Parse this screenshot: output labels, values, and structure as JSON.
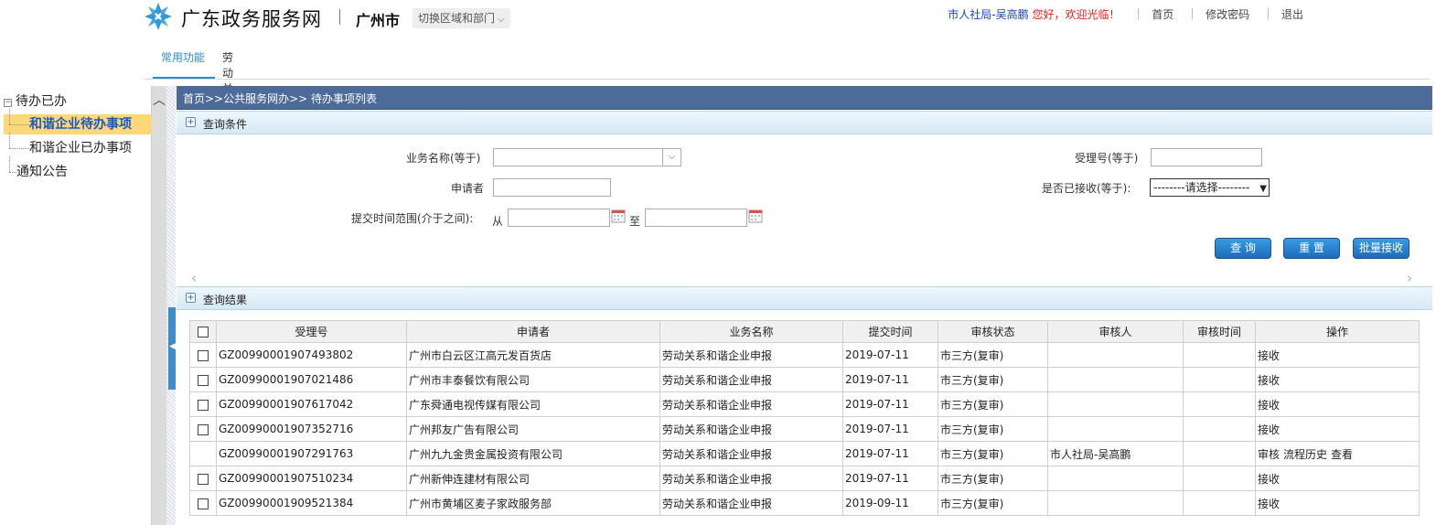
{
  "header": {
    "site_title": "广东政务服务网",
    "city": "广州市",
    "switch_label": "切换区域和部门",
    "user_name": "市人社局-吴高鹏",
    "welcome": " 您好，欢迎光临！",
    "nav": [
      "首页",
      "修改密码",
      "退出"
    ]
  },
  "tabs": [
    "常用功能",
    "劳动关系"
  ],
  "sidebar": {
    "root": "待办已办",
    "items": [
      "和谐企业待办事项",
      "和谐企业已办事项"
    ],
    "notice": "通知公告"
  },
  "breadcrumb": "首页>>公共服务网办>> 待办事项列表",
  "query": {
    "section_title": "查询条件",
    "biz_name_label": "业务名称(等于)",
    "biz_name_value": "",
    "applicant_label": "申请者",
    "applicant_value": "",
    "time_label": "提交时间范围(介于之间):",
    "from_label": "从",
    "to_label": "至",
    "accept_no_label": "受理号(等于)",
    "accept_no_value": "",
    "received_label": "是否已接收(等于):",
    "received_selected": "--------请选择--------",
    "buttons": [
      "查 询",
      "重 置",
      "批量接收"
    ]
  },
  "results": {
    "section_title": "查询结果",
    "columns": [
      "受理号",
      "申请者",
      "业务名称",
      "提交时间",
      "审核状态",
      "审核人",
      "审核时间",
      "操作"
    ],
    "rows": [
      {
        "checkbox": true,
        "accept_no": "GZ00990001907493802",
        "applicant": "广州市白云区江高元发百货店",
        "biz": "劳动关系和谐企业申报",
        "time": "2019-07-11",
        "status": "市三方(复审)",
        "reviewer": "",
        "review_time": "",
        "ops": [
          "接收"
        ]
      },
      {
        "checkbox": true,
        "accept_no": "GZ00990001907021486",
        "applicant": "广州市丰泰餐饮有限公司",
        "biz": "劳动关系和谐企业申报",
        "time": "2019-07-11",
        "status": "市三方(复审)",
        "reviewer": "",
        "review_time": "",
        "ops": [
          "接收"
        ]
      },
      {
        "checkbox": true,
        "accept_no": "GZ00990001907617042",
        "applicant": "广东舜通电视传媒有限公司",
        "biz": "劳动关系和谐企业申报",
        "time": "2019-07-11",
        "status": "市三方(复审)",
        "reviewer": "",
        "review_time": "",
        "ops": [
          "接收"
        ]
      },
      {
        "checkbox": true,
        "accept_no": "GZ00990001907352716",
        "applicant": "广州邦友广告有限公司",
        "biz": "劳动关系和谐企业申报",
        "time": "2019-07-11",
        "status": "市三方(复审)",
        "reviewer": "",
        "review_time": "",
        "ops": [
          "接收"
        ]
      },
      {
        "checkbox": false,
        "accept_no": "GZ00990001907291763",
        "applicant": "广州九九金贵金属投资有限公司",
        "biz": "劳动关系和谐企业申报",
        "time": "2019-07-11",
        "status": "市三方(复审)",
        "reviewer": "市人社局-吴高鹏",
        "review_time": "",
        "ops": [
          "审核",
          "流程历史",
          "查看"
        ]
      },
      {
        "checkbox": true,
        "accept_no": "GZ00990001907510234",
        "applicant": "广州新伸连建材有限公司",
        "biz": "劳动关系和谐企业申报",
        "time": "2019-07-11",
        "status": "市三方(复审)",
        "reviewer": "",
        "review_time": "",
        "ops": [
          "接收"
        ]
      },
      {
        "checkbox": true,
        "accept_no": "GZ00990001909521384",
        "applicant": "广州市黄埔区麦子家政服务部",
        "biz": "劳动关系和谐企业申报",
        "time": "2019-09-11",
        "status": "市三方(复审)",
        "reviewer": "",
        "review_time": "",
        "ops": [
          "接收"
        ]
      }
    ]
  }
}
